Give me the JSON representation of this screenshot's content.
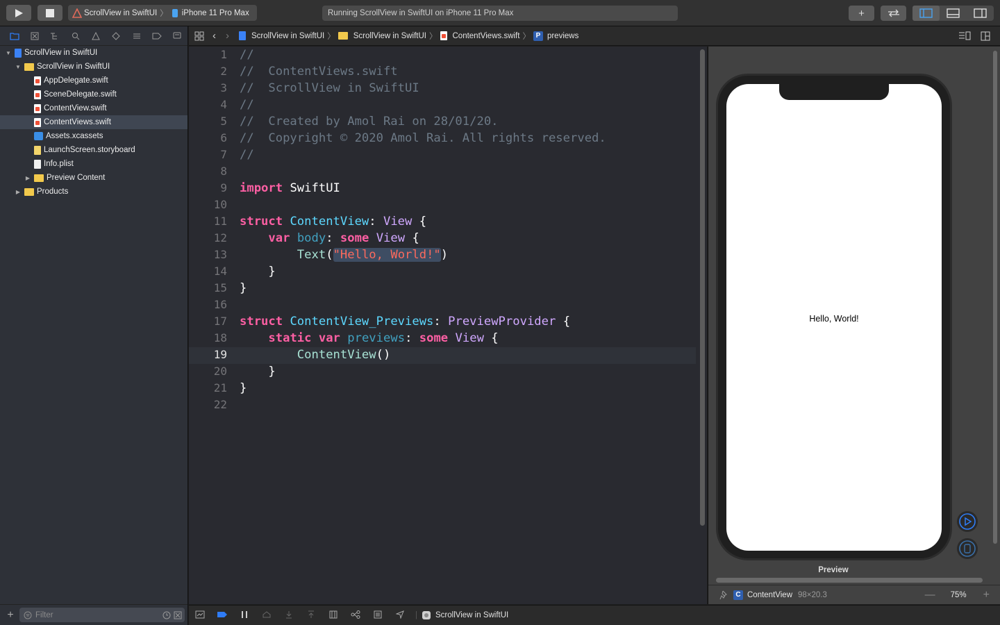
{
  "toolbar": {
    "scheme_project": "ScrollView in SwiftUI",
    "scheme_device": "iPhone 11 Pro Max",
    "status": "Running ScrollView in SwiftUI on iPhone 11 Pro Max"
  },
  "navigator": {
    "tree": [
      {
        "label": "ScrollView in SwiftUI",
        "icon": "project-icon"
      },
      {
        "label": "ScrollView in SwiftUI",
        "icon": "folder-icon"
      },
      {
        "label": "AppDelegate.swift",
        "icon": "swift-file-icon"
      },
      {
        "label": "SceneDelegate.swift",
        "icon": "swift-file-icon"
      },
      {
        "label": "ContentView.swift",
        "icon": "swift-file-icon"
      },
      {
        "label": "ContentViews.swift",
        "icon": "swift-file-icon",
        "selected": true
      },
      {
        "label": "Assets.xcassets",
        "icon": "asset-catalog-icon"
      },
      {
        "label": "LaunchScreen.storyboard",
        "icon": "storyboard-icon"
      },
      {
        "label": "Info.plist",
        "icon": "plist-icon"
      },
      {
        "label": "Preview Content",
        "icon": "folder-icon"
      },
      {
        "label": "Products",
        "icon": "folder-icon"
      }
    ],
    "filter_placeholder": "Filter"
  },
  "jumpbar": {
    "crumbs": [
      "ScrollView in SwiftUI",
      "ScrollView in SwiftUI",
      "ContentViews.swift",
      "previews"
    ],
    "symbol_letter": "P"
  },
  "editor": {
    "current_line": 19,
    "lines": [
      "//",
      "//  ContentViews.swift",
      "//  ScrollView in SwiftUI",
      "//",
      "//  Created by Amol Rai on 28/01/20.",
      "//  Copyright © 2020 Amol Rai. All rights reserved.",
      "//",
      "",
      "import SwiftUI",
      "",
      "struct ContentView: View {",
      "    var body: some View {",
      "        Text(\"Hello, World!\")",
      "    }",
      "}",
      "",
      "struct ContentView_Previews: PreviewProvider {",
      "    static var previews: some View {",
      "        ContentView()",
      "    }",
      "}",
      ""
    ]
  },
  "preview": {
    "screen_text": "Hello, World!",
    "label": "Preview",
    "footer": {
      "symbol_letter": "C",
      "name": "ContentView",
      "size": "98×20.3",
      "zoom": "75%"
    }
  },
  "debugbar": {
    "target": "ScrollView in SwiftUI"
  },
  "colors": {
    "accent": "#2f7cf6",
    "keyword": "#fc5fa3",
    "type": "#5dd8ff",
    "string": "#fc6a5d",
    "comment": "#6c7986"
  }
}
